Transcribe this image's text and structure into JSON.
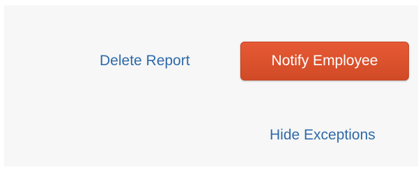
{
  "actions": {
    "delete_report_label": "Delete Report",
    "notify_employee_label": "Notify Employee",
    "hide_exceptions_label": "Hide Exceptions"
  },
  "colors": {
    "link": "#2f6aa9",
    "primary_button": "#dd5330",
    "panel_background": "#f7f7f7"
  }
}
